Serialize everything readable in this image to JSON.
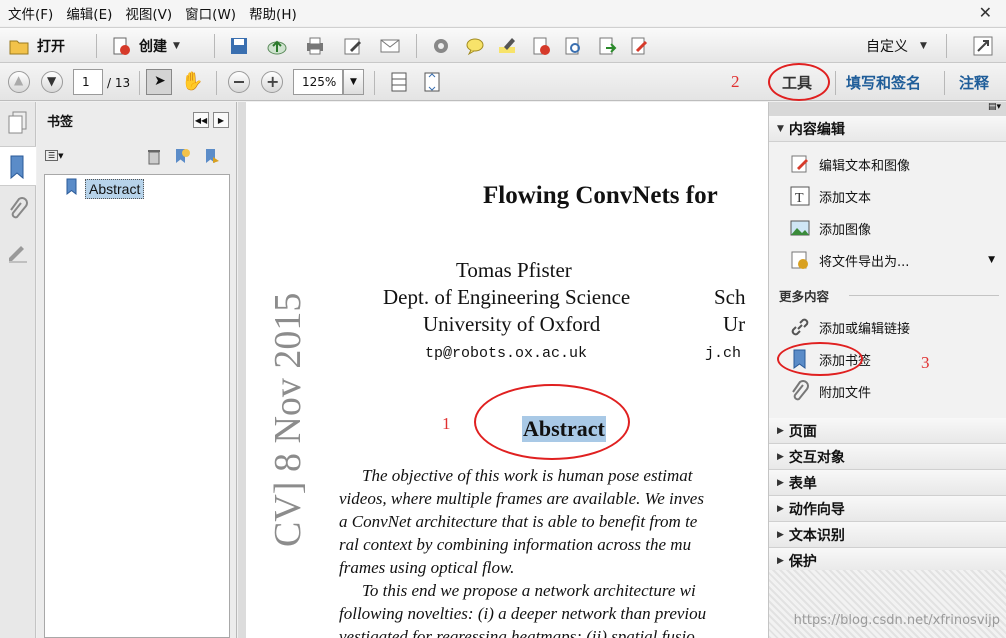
{
  "menu": [
    "文件(F)",
    "编辑(E)",
    "视图(V)",
    "窗口(W)",
    "帮助(H)"
  ],
  "toolbar1": {
    "open_label": "打开",
    "create_label": "创建",
    "customize_label": "自定义"
  },
  "toolbar2": {
    "current_page": "1",
    "total_pages": "/ 13",
    "zoom": "125%",
    "tools_label": "工具",
    "fill_sign_label": "填写和签名",
    "comment_label": "注释"
  },
  "bookmarks": {
    "title": "书签",
    "items": [
      "Abstract"
    ]
  },
  "document": {
    "title": "Flowing ConvNets for",
    "author_name": "Tomas Pfister",
    "author_dept": "Dept. of Engineering Science",
    "author_uni": "University of Oxford",
    "author_email": "tp@robots.ox.ac.uk",
    "col2_line1": "Sch",
    "col2_line2": "Ur",
    "col2_line3": "j.ch",
    "arxiv_stamp": "CV] 8 Nov 2015",
    "abstract_heading": "Abstract",
    "body_lines": [
      "The objective of this work is human pose estimat",
      "videos, where multiple frames are available. We inves",
      "a ConvNet architecture that is able to benefit from te",
      "ral context by combining information across the mu",
      "frames using optical flow.",
      "To this end we propose a network architecture wi",
      "following novelties: (i) a deeper network than previou",
      "vestigated for regressing heatmaps; (ii) spatial fusio"
    ]
  },
  "tools_pane": {
    "content_edit_header": "内容编辑",
    "items": [
      "编辑文本和图像",
      "添加文本",
      "添加图像",
      "将文件导出为..."
    ],
    "more_content_label": "更多内容",
    "more_items": [
      "添加或编辑链接",
      "添加书签",
      "附加文件"
    ],
    "sections": [
      "页面",
      "交互对象",
      "表单",
      "动作向导",
      "文本识别",
      "保护"
    ]
  },
  "annotations": [
    "1",
    "2",
    "3"
  ],
  "watermark": "https://blog.csdn.net/xfrinosvijp"
}
